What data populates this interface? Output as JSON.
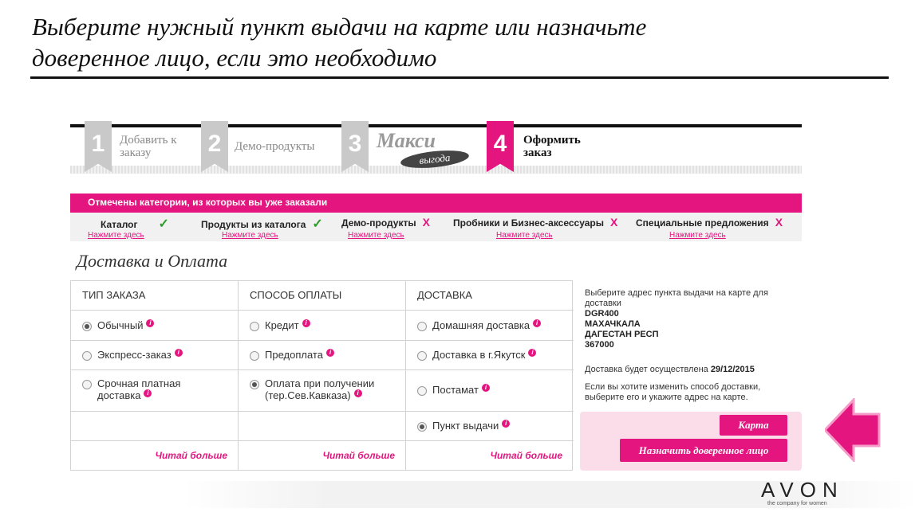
{
  "headline": [
    "Выберите нужный пункт выдачи на карте или назначьте",
    "доверенное лицо, если это необходимо"
  ],
  "steps": [
    {
      "number": "1",
      "label_lines": [
        "Добавить к",
        "заказу"
      ]
    },
    {
      "number": "2",
      "label_lines": [
        "Демо-продукты"
      ]
    },
    {
      "number": "3",
      "logo": "Макси",
      "logo_sub": "выгода"
    },
    {
      "number": "4",
      "label_lines": [
        "Оформить",
        "заказ"
      ]
    }
  ],
  "categories": {
    "title": "Отмечены категории, из которых вы уже заказали",
    "items": [
      {
        "label": "Каталог",
        "status": "✓",
        "link": "Нажмите здесь"
      },
      {
        "label": "Продукты из каталога",
        "status": "✓",
        "link": "Нажмите здесь"
      },
      {
        "label": "Демо-продукты",
        "status": "X",
        "link": "Нажмите здесь"
      },
      {
        "label": "Пробники и Бизнес-аксессуары",
        "status": "X",
        "link": "Нажмите здесь"
      },
      {
        "label": "Специальные предложения",
        "status": "X",
        "link": "Нажмите здесь"
      }
    ]
  },
  "section_title": "Доставка и Оплата",
  "table": {
    "order_type": {
      "header": "ТИП ЗАКАЗА",
      "options": [
        "Обычный",
        "Экспресс-заказ",
        "Срочная платная доставка"
      ],
      "selected": "Обычный"
    },
    "payment": {
      "header": "СПОСОБ ОПЛАТЫ",
      "options": [
        "Кредит",
        "Предоплата",
        "Оплата при получении (тер.Сев.Кавказа)"
      ],
      "selected": "Оплата при получении (тер.Сев.Кавказа)"
    },
    "delivery": {
      "header": "ДОСТАВКА",
      "options": [
        "Домашняя доставка",
        "Доставка в г.Якутск",
        "Постамат",
        "Пункт выдачи"
      ],
      "selected": "Пункт выдачи"
    },
    "more_label": "Читай больше"
  },
  "info": {
    "intro": "Выберите адрес пункта выдачи на карте для доставки",
    "address_lines": [
      "DGR400",
      "МАХАЧКАЛА",
      "ДАГЕСТАН РЕСП",
      "367000"
    ],
    "delivery_prefix": "Доставка будет осуществлена",
    "delivery_date": "29/12/2015",
    "change_note": "Если вы хотите изменить способ доставки, выберите его и укажите адрес на карте."
  },
  "buttons": {
    "map": "Карта",
    "proxy": "Назначить доверенное лицо"
  },
  "brand": {
    "name": "AVON",
    "tagline": "the company for women"
  },
  "colors": {
    "accent": "#e5157f",
    "check": "#2c9c2c"
  }
}
